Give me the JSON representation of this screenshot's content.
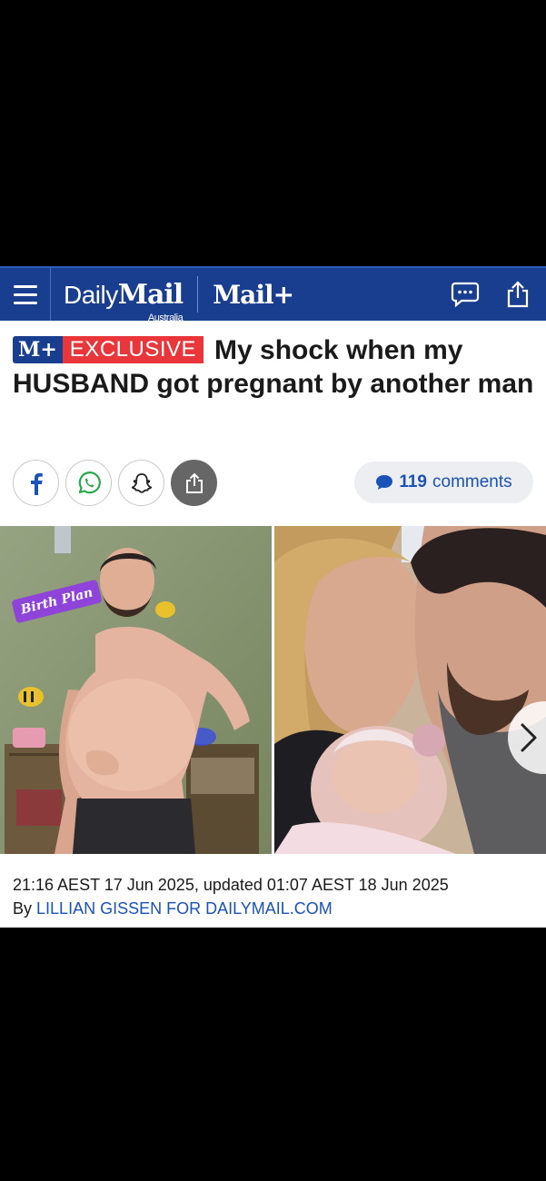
{
  "header": {
    "brand_daily": "Daily",
    "brand_mail": "Mail",
    "brand_region": "Australia",
    "brand_plus": "Mail+"
  },
  "article": {
    "badge_mplus": "M+",
    "badge_exclusive": "EXCLUSIVE",
    "headline": "My shock when my HUSBAND got pregnant by another man",
    "comments_count": "119",
    "comments_label": "comments",
    "image_left_label": "Birth Plan",
    "timestamp": "21:16 AEST 17 Jun 2025, updated 01:07 AEST 18 Jun 2025",
    "byline_prefix": "By",
    "byline_name": "LILLIAN GISSEN FOR DAILYMAIL.COM"
  },
  "colors": {
    "brand_blue": "#1a3e8f",
    "exclusive_red": "#e8363b",
    "link_blue": "#1a52b8"
  }
}
